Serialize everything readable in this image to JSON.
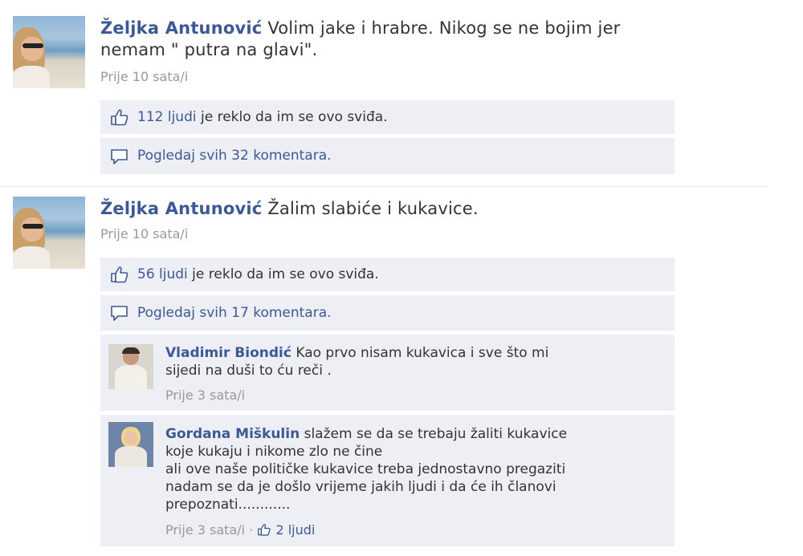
{
  "posts": [
    {
      "author": "Željka Antunović",
      "text_line1": "Volim jake i hrabre. Nikog se ne bojim jer",
      "text_line2": "nemam \" putra na glavi\".",
      "time": "Prije 10 sata/i",
      "likes_link": "112 ljudi",
      "likes_suffix": " je reklo da im se ovo sviđa.",
      "view_comments": "Pogledaj svih 32 komentara."
    },
    {
      "author": "Željka Antunović",
      "text_line1": "Žalim slabiće i kukavice.",
      "time": "Prije 10 sata/i",
      "likes_link": "56 ljudi",
      "likes_suffix": " je reklo da im se ovo sviđa.",
      "view_comments": "Pogledaj svih 17 komentara."
    }
  ],
  "comments": [
    {
      "author": "Vladimir Biondić",
      "line1": "Kao prvo nisam kukavica i sve što mi",
      "line2": "sijedi na duši to ću reči .",
      "time": "Prije 3 sata/i"
    },
    {
      "author": "Gordana Miškulin",
      "line1": "slažem se da se trebaju žaliti kukavice",
      "line2": "koje kukaju i nikome zlo ne čine",
      "line3": "ali ove naše političke kukavice treba jednostavno pregaziti",
      "line4": "nadam se da je došlo vrijeme jakih ljudi i da će ih članovi",
      "line5": "prepoznati............",
      "time": "Prije 3 sata/i",
      "separator": "·",
      "likes": "2 ljudi"
    }
  ],
  "icons": {
    "like": "thumbs-up-icon",
    "comment": "speech-bubble-icon"
  },
  "colors": {
    "link": "#3b5998",
    "ufi_bg": "#edeff4",
    "meta": "#999999"
  }
}
